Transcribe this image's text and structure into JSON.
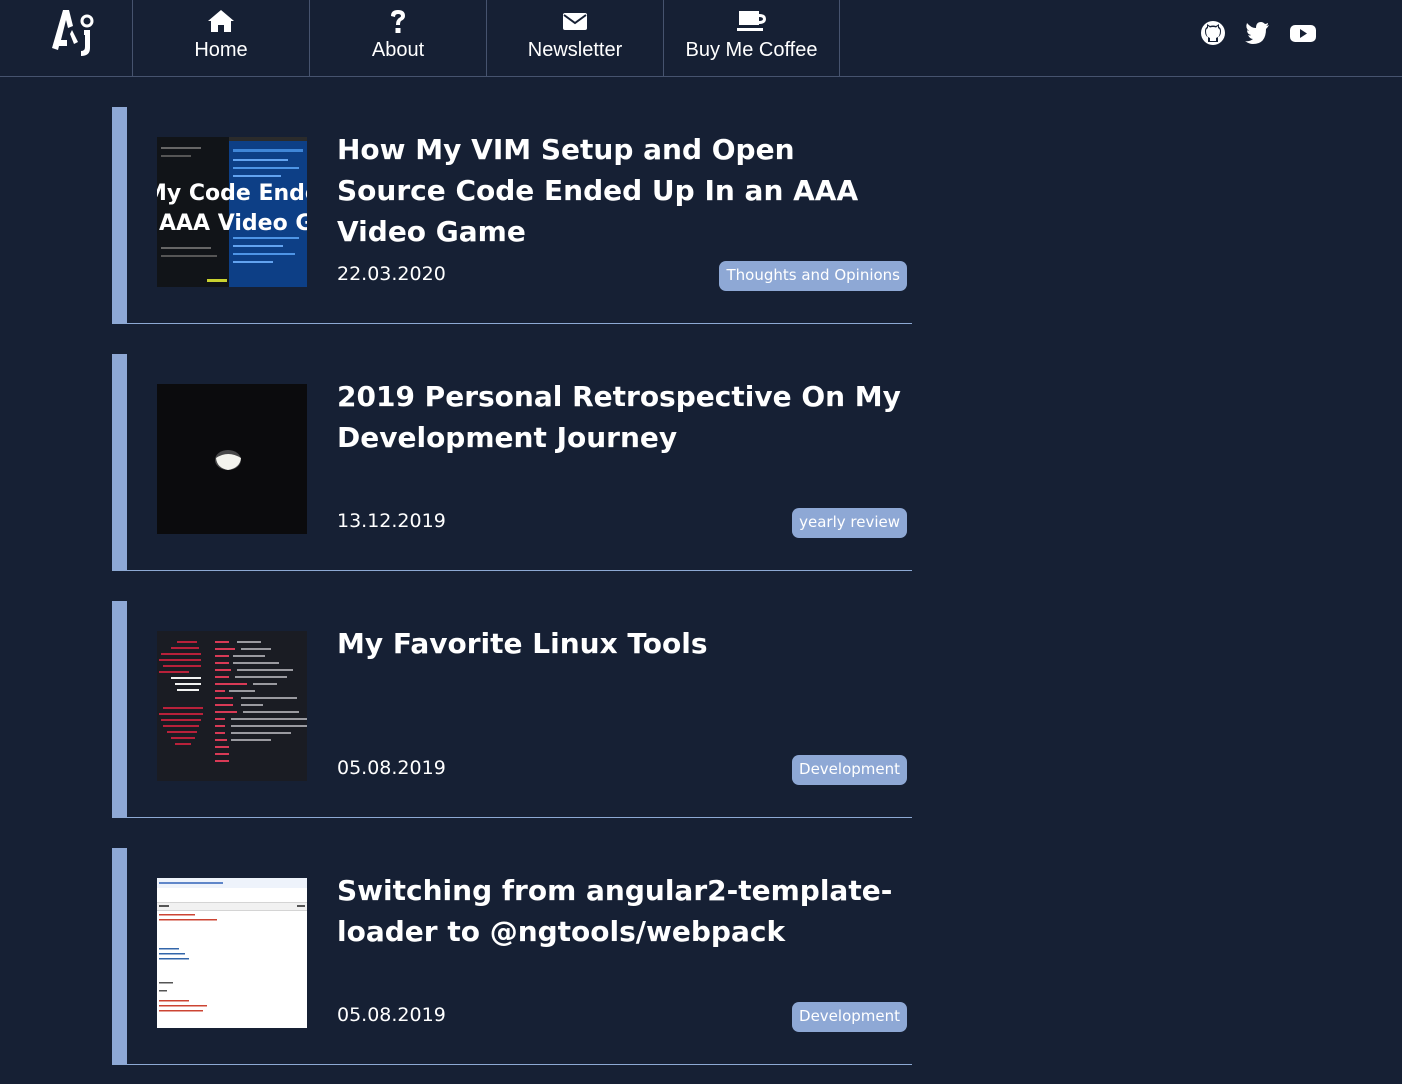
{
  "nav": {
    "logo_text": "Aj",
    "items": [
      {
        "label": "Home",
        "icon": "home-icon"
      },
      {
        "label": "About",
        "icon": "question-icon"
      },
      {
        "label": "Newsletter",
        "icon": "envelope-icon"
      },
      {
        "label": "Buy Me Coffee",
        "icon": "coffee-icon"
      }
    ],
    "social": [
      "github-icon",
      "twitter-icon",
      "youtube-icon"
    ]
  },
  "posts": [
    {
      "title": "How My VIM Setup and Open Source Code Ended Up In an AAA Video Game",
      "date": "22.03.2020",
      "tag": "Thoughts and Opinions",
      "thumb_text_1": "My Code Ended",
      "thumb_text_2": "AAA Video G"
    },
    {
      "title": "2019 Personal Retrospective On My Development Journey",
      "date": "13.12.2019",
      "tag": "yearly review"
    },
    {
      "title": "My Favorite Linux Tools",
      "date": "05.08.2019",
      "tag": "Development"
    },
    {
      "title": "Switching from angular2-template-loader to @ngtools/webpack",
      "date": "05.08.2019",
      "tag": "Development"
    }
  ],
  "colors": {
    "background": "#162034",
    "accent": "#8ea8d5",
    "divider": "#46536e"
  }
}
